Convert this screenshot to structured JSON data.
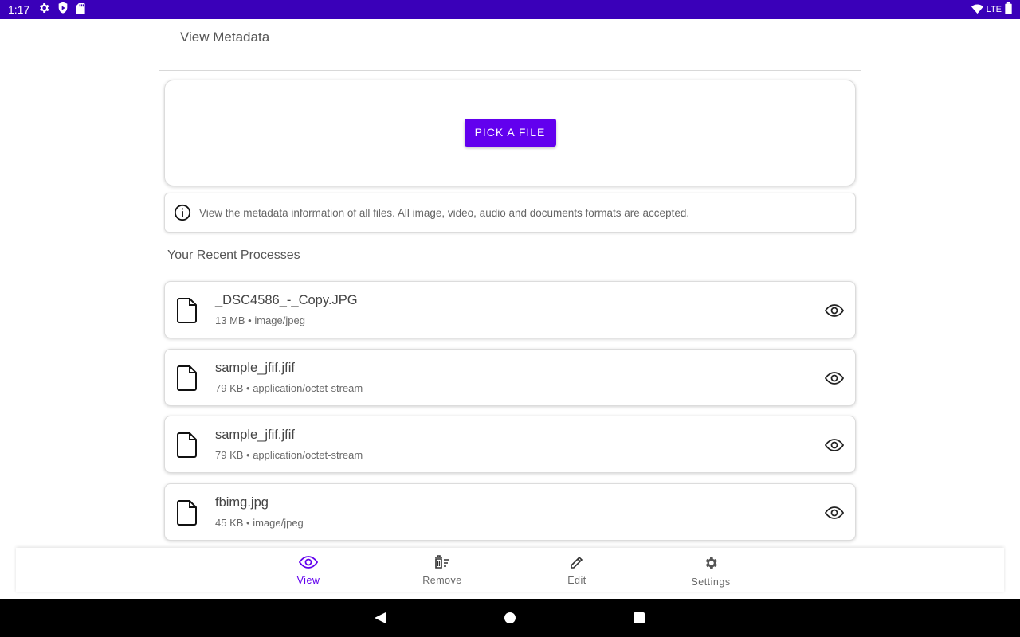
{
  "status_bar": {
    "time": "1:17",
    "network": "LTE",
    "left_icons": [
      "gear-icon",
      "shield-icon",
      "sd-card-icon"
    ],
    "right_icons": [
      "wifi-icon",
      "battery-icon"
    ],
    "color": "#3a00b9"
  },
  "header": {
    "title": "View Metadata"
  },
  "picker": {
    "button_label": "PICK A FILE",
    "accent": "#6200ee"
  },
  "info": {
    "text": "View the metadata information of all files. All image, video, audio and documents formats are accepted."
  },
  "recent": {
    "heading": "Your Recent Processes",
    "items": [
      {
        "name": "_DSC4586_-_Copy.JPG",
        "meta": "13 MB • image/jpeg"
      },
      {
        "name": "sample_jfif.jfif",
        "meta": "79 KB • application/octet-stream"
      },
      {
        "name": "sample_jfif.jfif",
        "meta": "79 KB • application/octet-stream"
      },
      {
        "name": "fbimg.jpg",
        "meta": "45 KB • image/jpeg"
      }
    ]
  },
  "bottom_nav": {
    "items": [
      {
        "label": "View",
        "icon": "eye-icon",
        "active": true
      },
      {
        "label": "Remove",
        "icon": "remove-list-icon",
        "active": false
      },
      {
        "label": "Edit",
        "icon": "pencil-icon",
        "active": false
      },
      {
        "label": "Settings",
        "icon": "gear-icon",
        "active": false
      }
    ]
  },
  "system_nav": {
    "buttons": [
      "back-icon",
      "home-icon",
      "recents-icon"
    ]
  }
}
